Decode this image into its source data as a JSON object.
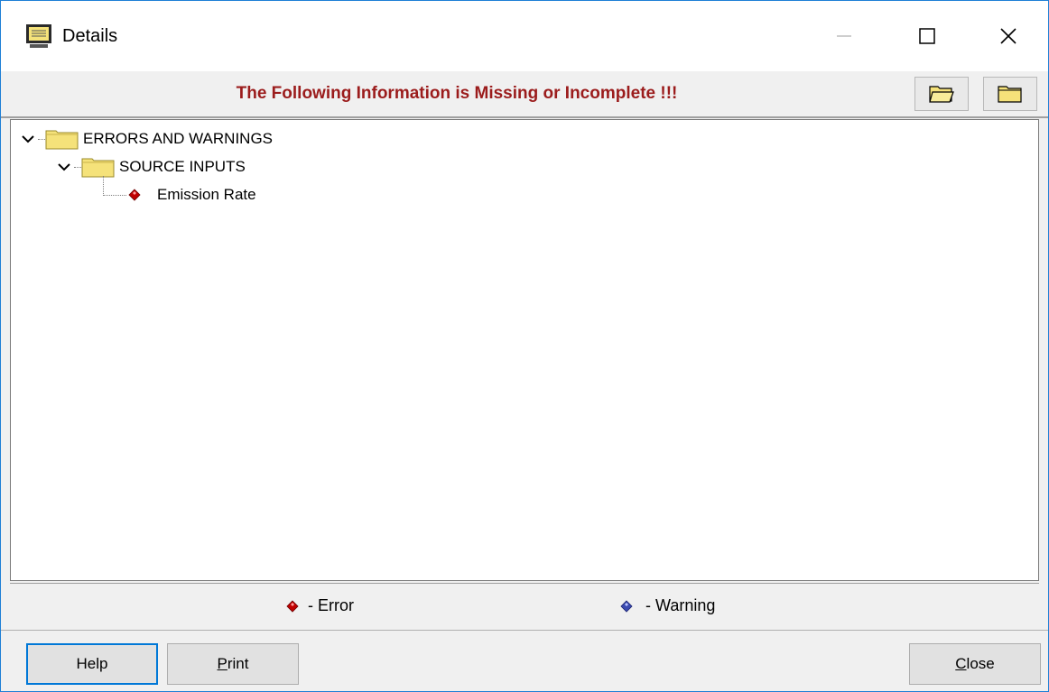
{
  "window": {
    "title": "Details"
  },
  "header": {
    "message": "The Following Information is Missing or Incomplete !!!"
  },
  "toolbar": {
    "expand_all_icon": "folder-open-icon",
    "collapse_all_icon": "folder-closed-icon"
  },
  "tree": {
    "root_label": "ERRORS AND WARNINGS",
    "child_label": "SOURCE INPUTS",
    "leaf_label": "Emission Rate"
  },
  "legend": {
    "error_label": "- Error",
    "warning_label": "- Warning"
  },
  "buttons": {
    "help": "Help",
    "print": "Print",
    "close": "Close"
  },
  "colors": {
    "header_text": "#9b1c1c",
    "error_marker": "#c00000",
    "warning_marker": "#3b4bb0",
    "folder": "#f5e27a",
    "accent": "#0078d7"
  }
}
